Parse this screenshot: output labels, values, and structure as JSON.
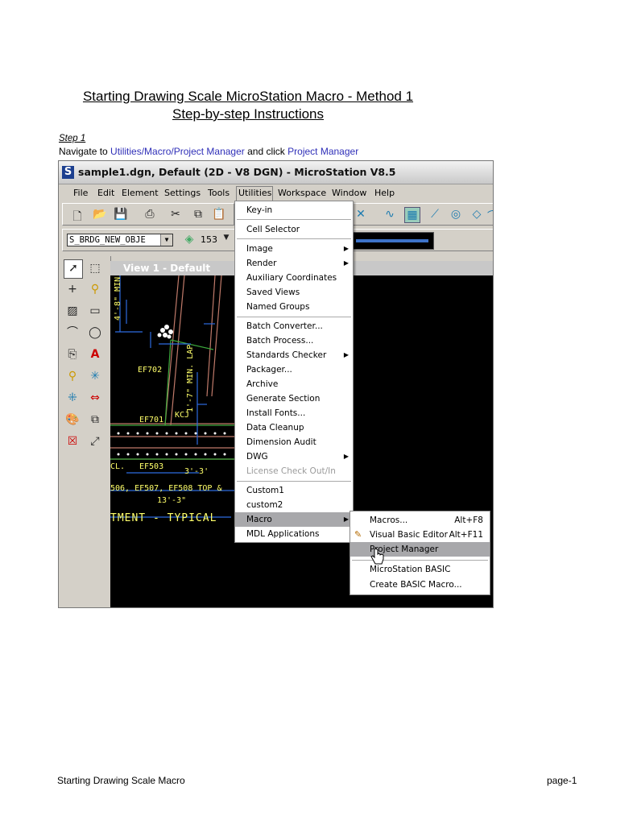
{
  "doc": {
    "title_line1": "Starting Drawing Scale MicroStation Macro - Method 1",
    "title_line2": "Step-by-step Instructions",
    "step_label": "Step 1",
    "instruction_prefix": "Navigate to ",
    "instruction_path": "Utilities/Macro/Project Manager",
    "instruction_middle": " and click ",
    "instruction_target": "Project Manager",
    "footer_left": "Starting Drawing Scale Macro",
    "footer_right": "page-1"
  },
  "app": {
    "title": "sample1.dgn, Default (2D - V8 DGN) - MicroStation V8.5",
    "menubar": [
      "File",
      "Edit",
      "Element",
      "Settings",
      "Tools",
      "Utilities",
      "Workspace",
      "Window",
      "Help"
    ],
    "active_menu": "Utilities",
    "level_value": "S_BRDG_NEW_OBJE",
    "color_value": "153",
    "view_title": "View 1 - Default"
  },
  "utilities_menu": [
    {
      "label": "Key-in"
    },
    {
      "label": "Cell Selector"
    },
    {
      "label": "Image",
      "submenu": true
    },
    {
      "label": "Render",
      "submenu": true
    },
    {
      "label": "Auxiliary Coordinates"
    },
    {
      "label": "Saved Views"
    },
    {
      "label": "Named Groups"
    },
    {
      "label": "Batch Converter..."
    },
    {
      "label": "Batch Process..."
    },
    {
      "label": "Standards Checker",
      "submenu": true
    },
    {
      "label": "Packager..."
    },
    {
      "label": "Archive"
    },
    {
      "label": "Generate Section"
    },
    {
      "label": "Install Fonts..."
    },
    {
      "label": "Data Cleanup"
    },
    {
      "label": "Dimension Audit"
    },
    {
      "label": "DWG",
      "submenu": true
    },
    {
      "label": "License Check Out/In",
      "disabled": true
    },
    {
      "label": "Custom1"
    },
    {
      "label": "custom2"
    },
    {
      "label": "Macro",
      "submenu": true,
      "highlighted": true
    },
    {
      "label": "MDL Applications"
    }
  ],
  "macro_submenu": [
    {
      "label": "Macros...",
      "shortcut": "Alt+F8"
    },
    {
      "label": "Visual Basic Editor",
      "shortcut": "Alt+F11"
    },
    {
      "label": "Project Manager",
      "highlighted": true
    },
    {
      "label": "MicroStation BASIC"
    },
    {
      "label": "Create BASIC Macro..."
    }
  ],
  "cad_labels": {
    "ef702": "EF702",
    "ef701": "EF701",
    "ef503": "EF503",
    "kcj": "KCJ",
    "min_lap": "1'-7\" MIN. LAP",
    "min": "4'-8\" MIN.",
    "dim1": "3'-3'",
    "row_text": "506, EF507, EF508 TOP &",
    "dim2": "13'-3\"",
    "cl": "CL.",
    "bottom": "TMENT - TYPICAL"
  },
  "colors": {
    "link": "#2f2fb8",
    "highlight": "#a8a8ab",
    "cad_text": "#ffff6a",
    "cad_bg": "#000000"
  }
}
